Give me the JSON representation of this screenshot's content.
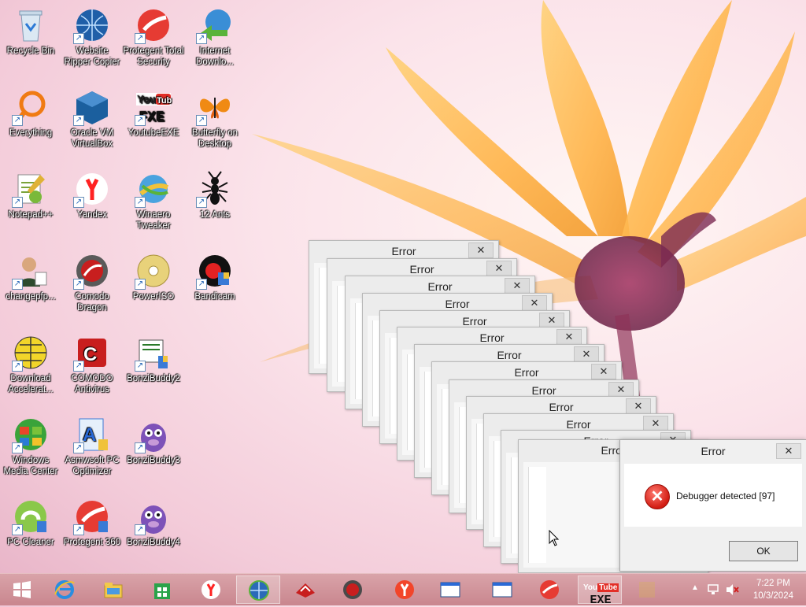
{
  "desktop": {
    "icons": [
      {
        "label": "Recycle Bin",
        "icon": "recycle-bin-icon"
      },
      {
        "label": "Website Ripper Copier",
        "icon": "globe-icon"
      },
      {
        "label": "Protegent Total Security",
        "icon": "protegent-icon"
      },
      {
        "label": "Internet Downlo...",
        "icon": "internet-download-manager-icon"
      },
      {
        "label": "Everything",
        "icon": "everything-search-icon"
      },
      {
        "label": "Oracle VM VirtualBox",
        "icon": "virtualbox-icon"
      },
      {
        "label": "YoutubeEXE",
        "icon": "youtube-exe-icon"
      },
      {
        "label": "Butterfly on Desktop",
        "icon": "butterfly-icon"
      },
      {
        "label": "Notepad++",
        "icon": "notepad-plus-plus-icon"
      },
      {
        "label": "Yandex",
        "icon": "yandex-icon"
      },
      {
        "label": "Winaero Tweaker",
        "icon": "winaero-tweaker-icon"
      },
      {
        "label": "12 Ants",
        "icon": "ant-icon"
      },
      {
        "label": "changepfp...",
        "icon": "user-avatar-icon"
      },
      {
        "label": "Comodo Dragon",
        "icon": "comodo-dragon-icon"
      },
      {
        "label": "PowerISO",
        "icon": "disc-icon"
      },
      {
        "label": "Bandicam",
        "icon": "bandicam-icon"
      },
      {
        "label": "Download Accelerat...",
        "icon": "download-accelerator-icon"
      },
      {
        "label": "COMODO Antivirus",
        "icon": "comodo-antivirus-icon"
      },
      {
        "label": "BonziBuddy2",
        "icon": "installer-icon"
      },
      {
        "label": "",
        "icon": "empty"
      },
      {
        "label": "Windows Media Center",
        "icon": "media-center-icon"
      },
      {
        "label": "Asmwsoft PC Optimizer",
        "icon": "pc-optimizer-icon"
      },
      {
        "label": "BonziBuddy3",
        "icon": "bonzi-icon"
      },
      {
        "label": "",
        "icon": "empty"
      },
      {
        "label": "PC Cleaner",
        "icon": "pc-cleaner-icon"
      },
      {
        "label": "Protegent 360",
        "icon": "protegent-360-icon"
      },
      {
        "label": "BonziBuddy4",
        "icon": "bonzi-icon"
      }
    ]
  },
  "error_windows": {
    "title": "Error",
    "close_glyph": "✕",
    "front": {
      "title": "Error",
      "message": "Debugger detected [97]",
      "ok_label": "OK",
      "close_glyph": "✕"
    }
  },
  "taskbar": {
    "buttons": [
      {
        "icon": "windows-start-icon"
      },
      {
        "icon": "internet-explorer-icon"
      },
      {
        "icon": "file-explorer-icon"
      },
      {
        "icon": "windows-store-icon"
      },
      {
        "icon": "yandex-icon"
      },
      {
        "icon": "globe-icon"
      },
      {
        "icon": "comodo-antivirus-icon"
      },
      {
        "icon": "comodo-dragon-icon"
      },
      {
        "icon": "yandex-browser-icon"
      },
      {
        "icon": "window-icon"
      },
      {
        "icon": "window-icon"
      },
      {
        "icon": "protegent-icon"
      },
      {
        "icon": "youtube-exe-icon"
      },
      {
        "icon": "blank-app-icon"
      }
    ],
    "youtube_label": "You",
    "youtube_label2": "Tube",
    "youtube_exe": "EXE",
    "tray": {
      "time": "7:22 PM",
      "date": "10/3/2024"
    }
  }
}
